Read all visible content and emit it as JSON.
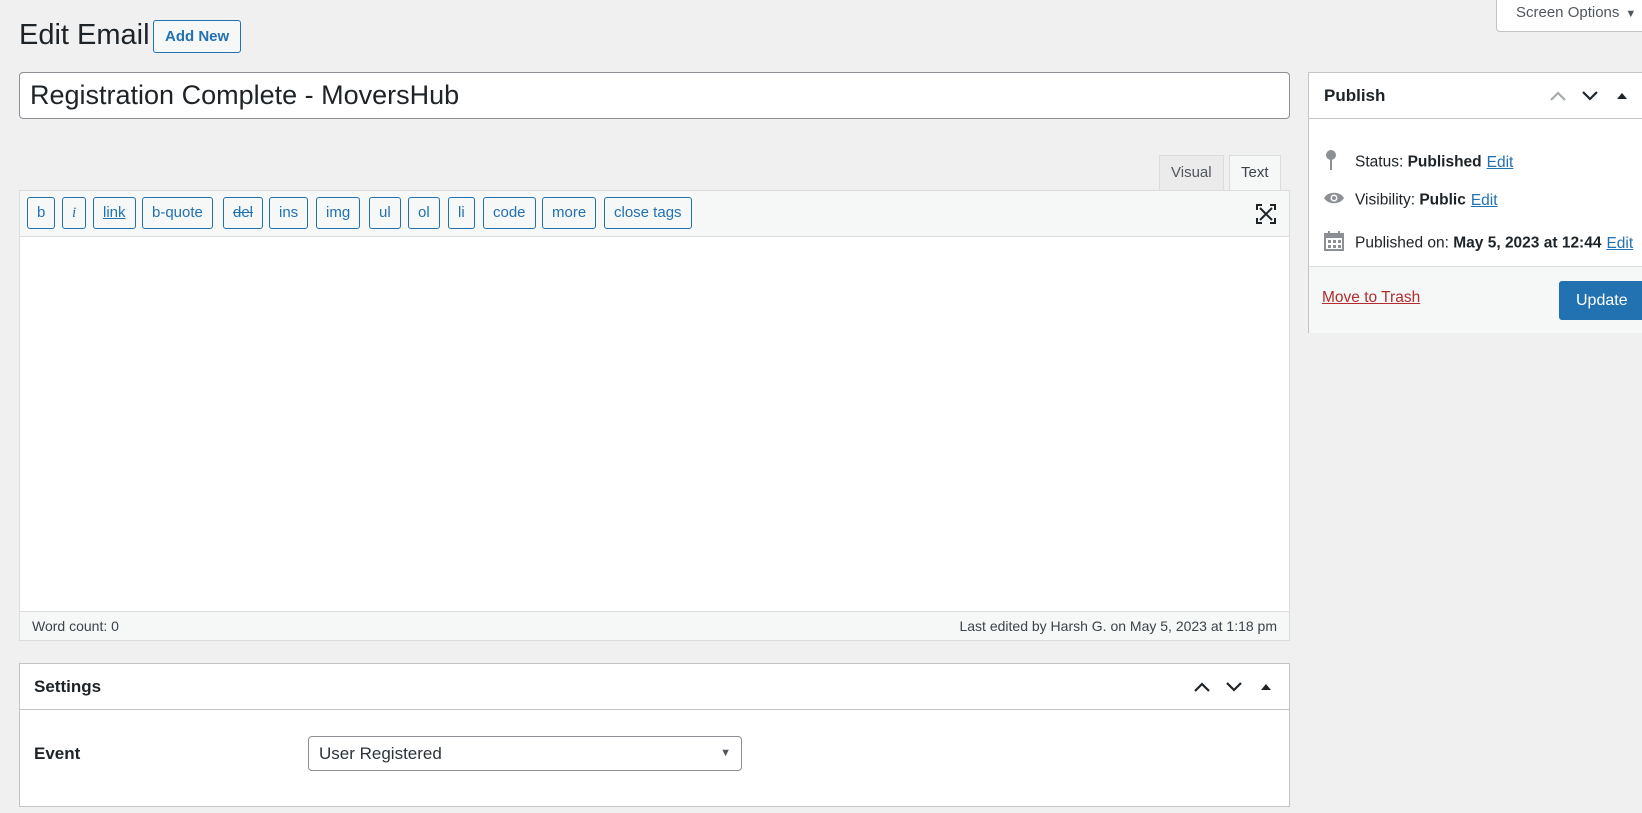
{
  "screen_options": {
    "label": "Screen Options"
  },
  "header": {
    "title": "Edit Email",
    "add_new": "Add New"
  },
  "post": {
    "title": "Registration Complete - MoversHub"
  },
  "editor": {
    "tabs": [
      {
        "label": "Visual",
        "active": false
      },
      {
        "label": "Text",
        "active": true
      }
    ],
    "quicktags": [
      "b",
      "i",
      "link",
      "b-quote",
      "del",
      "ins",
      "img",
      "ul",
      "ol",
      "li",
      "code",
      "more",
      "close tags"
    ],
    "content": "",
    "word_count": "Word count: 0",
    "last_edited": "Last edited by Harsh G. on May 5, 2023 at 1:18 pm"
  },
  "settings": {
    "title": "Settings",
    "event_label": "Event",
    "event_value": "User Registered"
  },
  "publish": {
    "title": "Publish",
    "status_label": "Status:",
    "status_value": "Published",
    "visibility_label": "Visibility:",
    "visibility_value": "Public",
    "published_label": "Published on:",
    "published_value": "May 5, 2023 at 12:44",
    "edit_link": "Edit",
    "trash": "Move to Trash",
    "update": "Update"
  },
  "colors": {
    "accent": "#2271b1",
    "danger": "#b32d2e",
    "background": "#f0f0f1"
  }
}
